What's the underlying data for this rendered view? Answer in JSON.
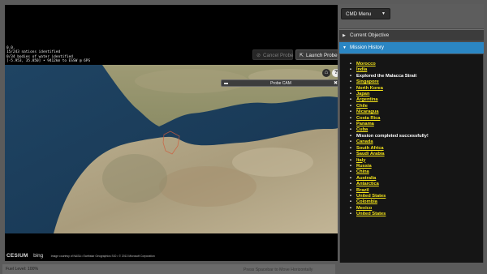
{
  "hud": {
    "lines": [
      "0.0.",
      "15/243 nations identified",
      "0/34 bodies of water identified",
      "[-5.953, 35.850] • 9412km to ESSW @ 6PS"
    ]
  },
  "controls": {
    "cancel_probe": "Cancel Probe",
    "launch_probe": "Launch Probe",
    "home_icon": "home-icon",
    "help_label": "?"
  },
  "probe_cam": {
    "title": "Probe CAM",
    "close": "✖"
  },
  "credits": {
    "logo": "CESIUM",
    "bing": "bing",
    "text": "Image courtesy of NASA • Earthstar Geographics SIO • © 2013 Microsoft Corporation"
  },
  "status": {
    "fuel": "Fuel Level: 100%",
    "hint": "Press Spacebar to Move Horizontally"
  },
  "panel": {
    "cmd_menu": "CMD Menu",
    "current_objective": "Current Objective",
    "mission_history": "Mission History",
    "history": [
      {
        "text": "Morocco",
        "link": true
      },
      {
        "text": "India",
        "link": true
      },
      {
        "text": "Explored the Malacca Strait",
        "link": false
      },
      {
        "text": "Singapore",
        "link": true
      },
      {
        "text": "North Korea",
        "link": true
      },
      {
        "text": "Japan",
        "link": true
      },
      {
        "text": "Argentina",
        "link": true
      },
      {
        "text": "Chile",
        "link": true
      },
      {
        "text": "Nicaragua",
        "link": true
      },
      {
        "text": "Costa Rica",
        "link": true
      },
      {
        "text": "Panama",
        "link": true
      },
      {
        "text": "Cuba",
        "link": true
      },
      {
        "text": "Mission completed successfully!",
        "link": false
      },
      {
        "text": "Canada",
        "link": true
      },
      {
        "text": "South Africa",
        "link": true
      },
      {
        "text": "Saudi Arabia",
        "link": true
      },
      {
        "text": "Italy",
        "link": true
      },
      {
        "text": "Russia",
        "link": true
      },
      {
        "text": "China",
        "link": true
      },
      {
        "text": "Australia",
        "link": true
      },
      {
        "text": "Antarctica",
        "link": true
      },
      {
        "text": "Brazil",
        "link": true
      },
      {
        "text": "United States",
        "link": true
      },
      {
        "text": "Colombia",
        "link": true
      },
      {
        "text": "Mexico",
        "link": true
      },
      {
        "text": "United States",
        "link": true
      }
    ]
  },
  "colors": {
    "accent": "#2b86c3",
    "link": "#f2e21b",
    "sea": "#1b3b5a",
    "land": "#b3a88a"
  }
}
